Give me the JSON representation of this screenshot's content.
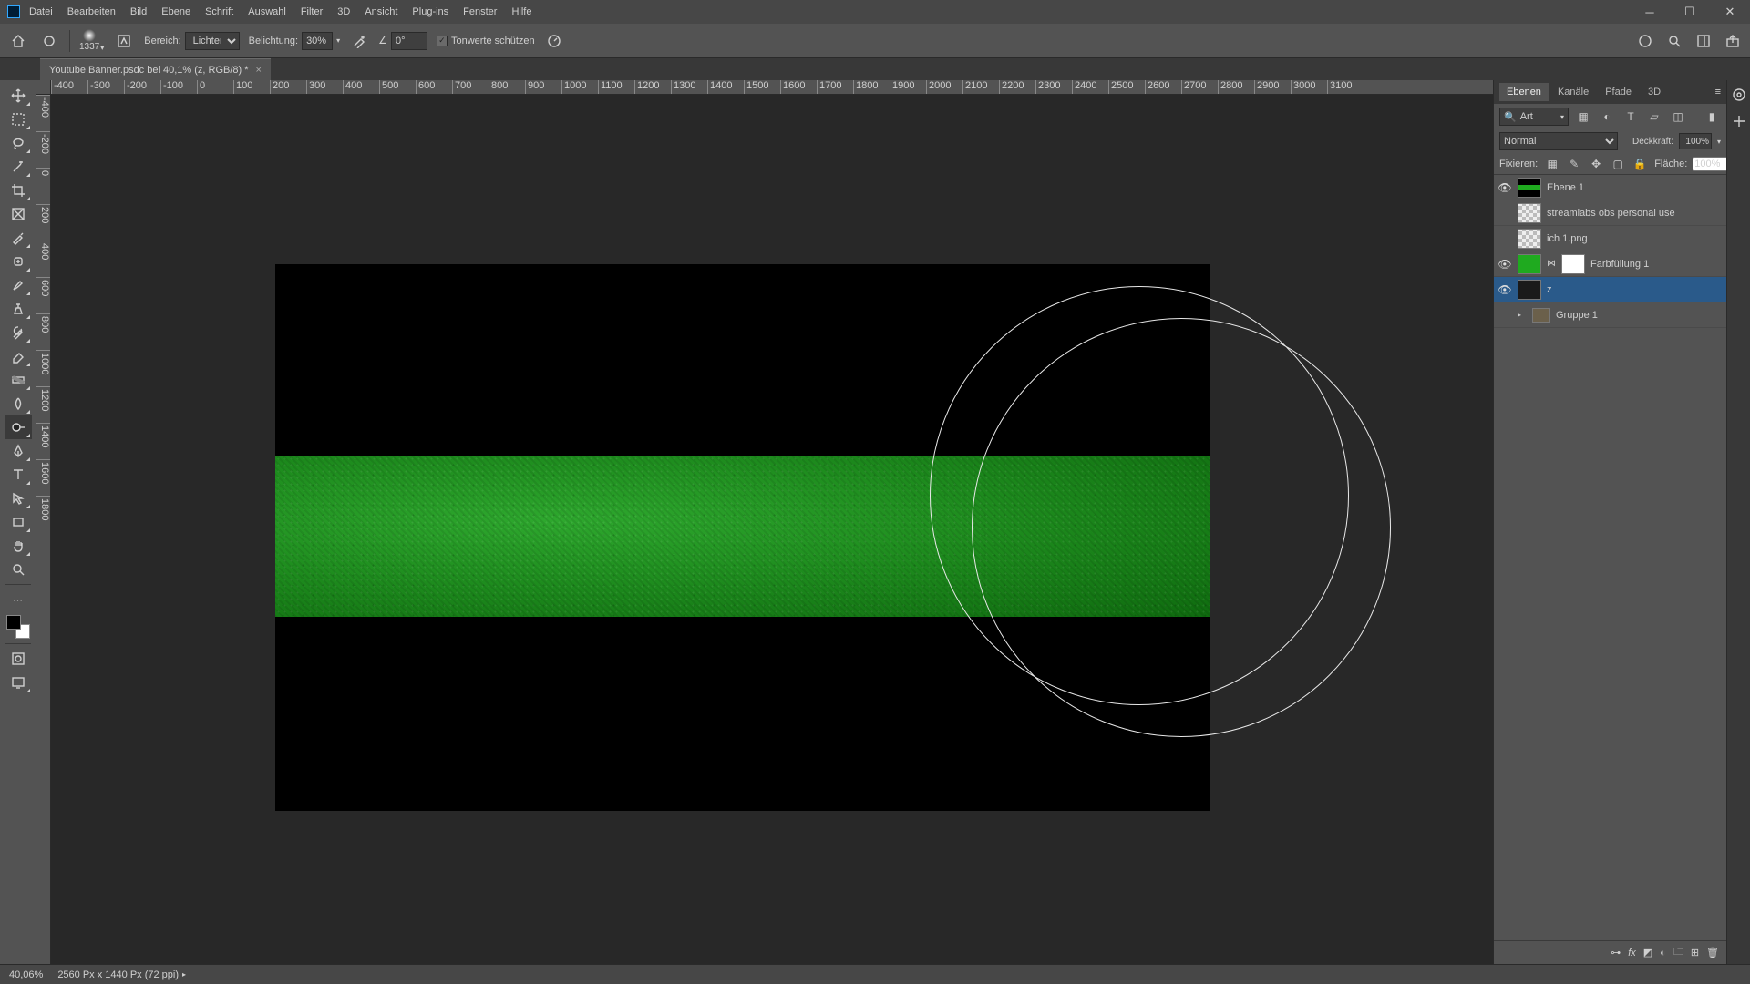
{
  "menu": [
    "Datei",
    "Bearbeiten",
    "Bild",
    "Ebene",
    "Schrift",
    "Auswahl",
    "Filter",
    "3D",
    "Ansicht",
    "Plug-ins",
    "Fenster",
    "Hilfe"
  ],
  "options": {
    "brush_size": "1337",
    "range_label": "Bereich:",
    "range_value": "Lichter",
    "exposure_label": "Belichtung:",
    "exposure_value": "30%",
    "angle": "0°",
    "protect_tones": "Tonwerte schützen"
  },
  "doc_tab": "Youtube Banner.psdc bei 40,1% (z, RGB/8) *",
  "h_ruler_ticks": [
    "-400",
    "-300",
    "-200",
    "-100",
    "0",
    "100",
    "200",
    "300",
    "400",
    "500",
    "600",
    "700",
    "800",
    "900",
    "1000",
    "1100",
    "1200",
    "1300",
    "1400",
    "1500",
    "1600",
    "1700",
    "1800",
    "1900",
    "2000",
    "2100",
    "2200",
    "2300",
    "2400",
    "2500",
    "2600",
    "2700",
    "2800",
    "2900",
    "3000",
    "3100"
  ],
  "v_ruler_ticks": [
    "-400",
    "-200",
    "0",
    "200",
    "400",
    "600",
    "800",
    "1000",
    "1200",
    "1400",
    "1600",
    "1800"
  ],
  "panel": {
    "tabs": [
      "Ebenen",
      "Kanäle",
      "Pfade",
      "3D"
    ],
    "filter": "Art",
    "blend_mode": "Normal",
    "opacity_label": "Deckkraft:",
    "opacity_value": "100%",
    "lock_label": "Fixieren:",
    "fill_label": "Fläche:",
    "fill_value": "100%"
  },
  "layers": [
    {
      "visible": true,
      "name": "Ebene 1",
      "thumbs": [
        "bw"
      ]
    },
    {
      "visible": false,
      "name": "streamlabs obs personal use",
      "thumbs": [
        "img"
      ]
    },
    {
      "visible": false,
      "name": "ich 1.png",
      "thumbs": [
        "img"
      ]
    },
    {
      "visible": true,
      "name": "Farbfüllung 1",
      "thumbs": [
        "green",
        "link",
        "white"
      ]
    },
    {
      "visible": true,
      "name": "z",
      "thumbs": [
        "dark"
      ],
      "selected": true
    },
    {
      "visible": false,
      "name": "Gruppe 1",
      "group": true
    }
  ],
  "status": {
    "zoom": "40,06%",
    "dims": "2560 Px x 1440 Px (72 ppi)"
  }
}
